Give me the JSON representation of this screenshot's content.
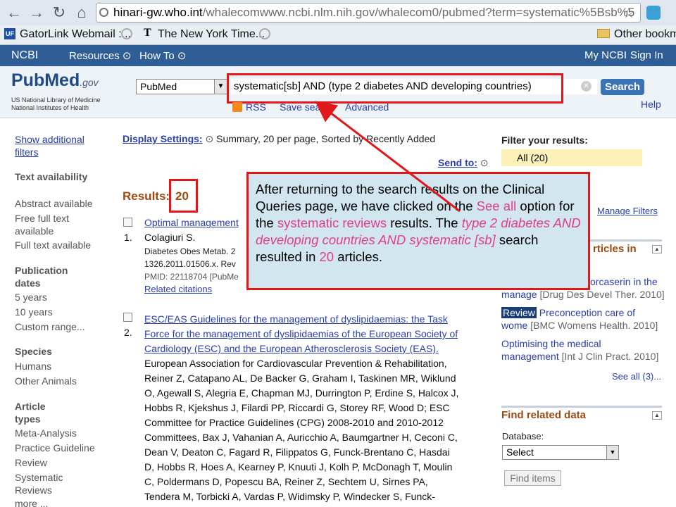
{
  "browser": {
    "url_domain": "hinari-gw.who.int",
    "url_path": "/whalecomwww.ncbi.nlm.nih.gov/whalecom0/pubmed?term=systematic%5Bsb%5"
  },
  "bookmarks": [
    "GatorLink Webmail :...",
    "The New York Time...",
    "Other bookm"
  ],
  "ncbi": {
    "logo": "NCBI",
    "resources": "Resources",
    "howto": "How To",
    "mync": "My NCBI",
    "signin": "Sign In"
  },
  "header": {
    "logo": "PubMed",
    "logo_gov": ".gov",
    "nlm": "US National Library of Medicine",
    "nih": "National Institutes of Health",
    "db": "PubMed",
    "term": "systematic[sb] AND (type 2 diabetes AND developing countries)",
    "search": "Search",
    "rss": "RSS",
    "save": "Save search",
    "advanced": "Advanced",
    "help": "Help"
  },
  "left": {
    "show": "Show additional filters",
    "text_avail": "Text availability",
    "abstract": "Abstract available",
    "free": "Free full text available",
    "full": "Full text available",
    "pubdates": "Publication dates",
    "y5": "5 years",
    "y10": "10 years",
    "custom": "Custom range...",
    "species": "Species",
    "humans": "Humans",
    "animals": "Other Animals",
    "article_types": "Article types",
    "meta": "Meta-Analysis",
    "practice": "Practice Guideline",
    "review": "Review",
    "sysrev": "Systematic Reviews",
    "more": "more ..."
  },
  "display": {
    "label": "Display Settings:",
    "value": "Summary, 20 per page, Sorted by Recently Added",
    "sendto": "Send to:"
  },
  "results": {
    "label": "Results:",
    "count": "20"
  },
  "items": [
    {
      "num": "1.",
      "title": "Optimal management",
      "authors": "Colagiuri S.",
      "journal": "Diabetes Obes Metab. 2",
      "doi": "1326.2011.01506.x. Rev",
      "pmid": "PMID: 22118704 [PubMe",
      "related": "Related citations"
    },
    {
      "num": "2.",
      "t1": "ESC/EAS Guidelines for the management of dyslipidaemias: the Task",
      "t2": "Force for the management of dyslipidaemias of the European Society of",
      "t3": "Cardiology (ESC) and the European Atherosclerosis Society (EAS).",
      "a1": "European Association for Cardiovascular Prevention & Rehabilitation,",
      "a2": "Reiner Z, Catapano AL, De Backer G, Graham I, Taskinen MR, Wiklund",
      "a3": "O, Agewall S, Alegria E, Chapman MJ, Durrington P, Erdine S, Halcox J,",
      "a4": "Hobbs R, Kjekshus J, Filardi PP, Riccardi G, Storey RF, Wood D; ESC",
      "a5": "Committee for Practice Guidelines (CPG) 2008-2010 and 2010-2012",
      "a6": "Committees, Bax J, Vahanian A, Auricchio A, Baumgartner H, Ceconi C,",
      "a7": "Dean V, Deaton C, Fagard R, Filippatos G, Funck-Brentano C, Hasdai",
      "a8": "D, Hobbs R, Hoes A, Kearney P, Knuuti J, Kolh P, McDonagh T, Moulin",
      "a9": "C, Poldermans D, Popescu BA, Reiner Z, Sechtem U, Sirnes PA,",
      "a10": "Tendera M, Torbicki A, Vardas P, Widimsky P, Windecker S, Funck-"
    }
  ],
  "callout": {
    "p1": "After returning to the search results on the Clinical Queries page, we have clicked on the ",
    "see_all": "See all",
    "p2": " option for the ",
    "sysrev": "systematic reviews",
    "p3": " results. The ",
    "query": "type 2 diabetes AND developing countries AND systematic [sb]",
    "p4": " search resulted in ",
    "count": "20",
    "p5": " articles."
  },
  "right": {
    "filter_title": "Filter your results:",
    "all": "All (20)",
    "manage": "Manage Filters",
    "titles_head": "rticles in",
    "r1a": "orcaserin in the",
    "r1b": "manage",
    "r1c": "[Drug Des Devel Ther. 2010]",
    "review_badge": "Review",
    "r2a": "Preconception care of",
    "r2b": "wome",
    "r2c": "[BMC Womens Health. 2010]",
    "r3a": "Optimising the medical",
    "r3b": "management",
    "r3c": "[Int J Clin Pract. 2010]",
    "seeall": "See all (3)...",
    "find_head": "Find related data",
    "database": "Database:",
    "select": "Select",
    "find_btn": "Find items"
  },
  "colors": {
    "accent": "#e0171b",
    "ncbi": "#2f5d96",
    "pink": "#e23b8f"
  }
}
